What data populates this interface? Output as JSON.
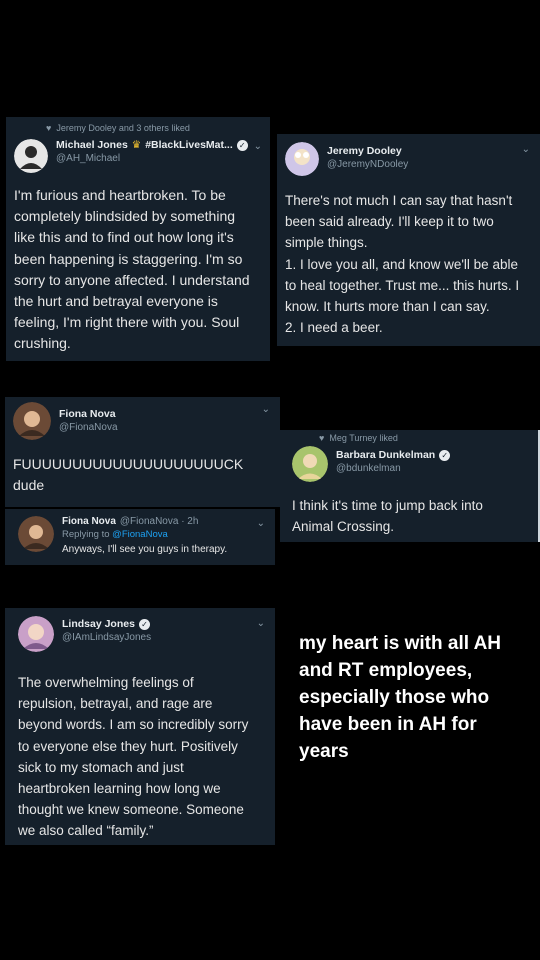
{
  "tweets": {
    "michael": {
      "context": "Jeremy Dooley and 3 others liked",
      "name": "Michael Jones",
      "name_extra": "#BlackLivesMat...",
      "handle": "@AH_Michael",
      "lines": [
        "I'm furious and heartbroken. To be",
        "completely blindsided by something",
        "like this and to find out how long it's",
        "been happening is staggering. I'm so",
        "sorry to anyone affected. I understand",
        "the hurt and betrayal everyone is",
        "feeling, I'm right there with you. Soul",
        "crushing."
      ]
    },
    "jeremy": {
      "name": "Jeremy Dooley",
      "handle": "@JeremyNDooley",
      "lines": [
        "There's not much I can say that hasn't",
        "been said already. I'll keep it to two",
        "simple things.",
        "1. I love you all, and know we'll be able",
        "to heal together. Trust me... this hurts. I",
        "know. It hurts more than I can say.",
        "2. I need a beer."
      ]
    },
    "fiona": {
      "name": "Fiona Nova",
      "handle": "@FionaNova",
      "lines": [
        "FUUUUUUUUUUUUUUUUUUUUCK",
        "dude"
      ]
    },
    "fiona_reply": {
      "name": "Fiona Nova",
      "handle_time": "@FionaNova · 2h",
      "replying_prefix": "Replying to",
      "replying_handle": "@FionaNova",
      "text": "Anyways, I'll see you guys in therapy."
    },
    "barbara": {
      "context": "Meg Turney liked",
      "name": "Barbara Dunkelman",
      "handle": "@bdunkelman",
      "lines": [
        "I think it's time to jump back into",
        "Animal Crossing."
      ]
    },
    "lindsay": {
      "name": "Lindsay Jones",
      "handle": "@IAmLindsayJones",
      "lines": [
        "The overwhelming feelings of",
        "repulsion, betrayal, and rage are",
        "beyond words. I am so incredibly sorry",
        "to everyone else they hurt. Positively",
        "sick to my stomach and just",
        "heartbroken learning how long we",
        "thought we knew someone. Someone",
        "we also called “family.”"
      ]
    }
  },
  "overlay_lines": [
    "my heart is with all AH",
    "and RT employees,",
    "especially those who",
    "have been in AH for",
    "years"
  ],
  "colors": {
    "card_bg": "#15202b",
    "secondary_text": "#8899a6",
    "link": "#1da1f2"
  }
}
